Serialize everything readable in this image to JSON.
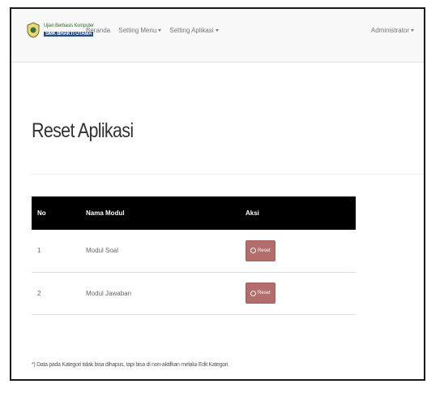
{
  "navbar": {
    "logo": {
      "line1": "Ujian Berbasis Komputer",
      "line2": "SMK BHAKTI UTAMA"
    },
    "links": [
      {
        "label": "Beranda",
        "dropdown": false
      },
      {
        "label": "Setting Menu",
        "dropdown": true
      },
      {
        "label": "Setting Aplikasi",
        "dropdown": true
      }
    ],
    "user_label": "Administrator"
  },
  "page": {
    "title": "Reset Aplikasi"
  },
  "table": {
    "headers": [
      "No",
      "Nama Modul",
      "Aksi"
    ],
    "rows": [
      {
        "no": "1",
        "nama": "Modul Soal",
        "action_label": "Reset"
      },
      {
        "no": "2",
        "nama": "Modul Jawaban",
        "action_label": "Reset"
      }
    ]
  },
  "footnote": "*) Data pada Kategori tidak bisa dihapus, tapi bisa di non-aktifkan melalui Edit Kategori.",
  "colors": {
    "header_bg": "#000000",
    "reset_button": "#b56c6c",
    "navbar_bg": "#f8f8f8"
  },
  "icons": {
    "logo": "school-seal-icon",
    "reset": "refresh-icon",
    "dropdown": "caret-down-icon"
  }
}
